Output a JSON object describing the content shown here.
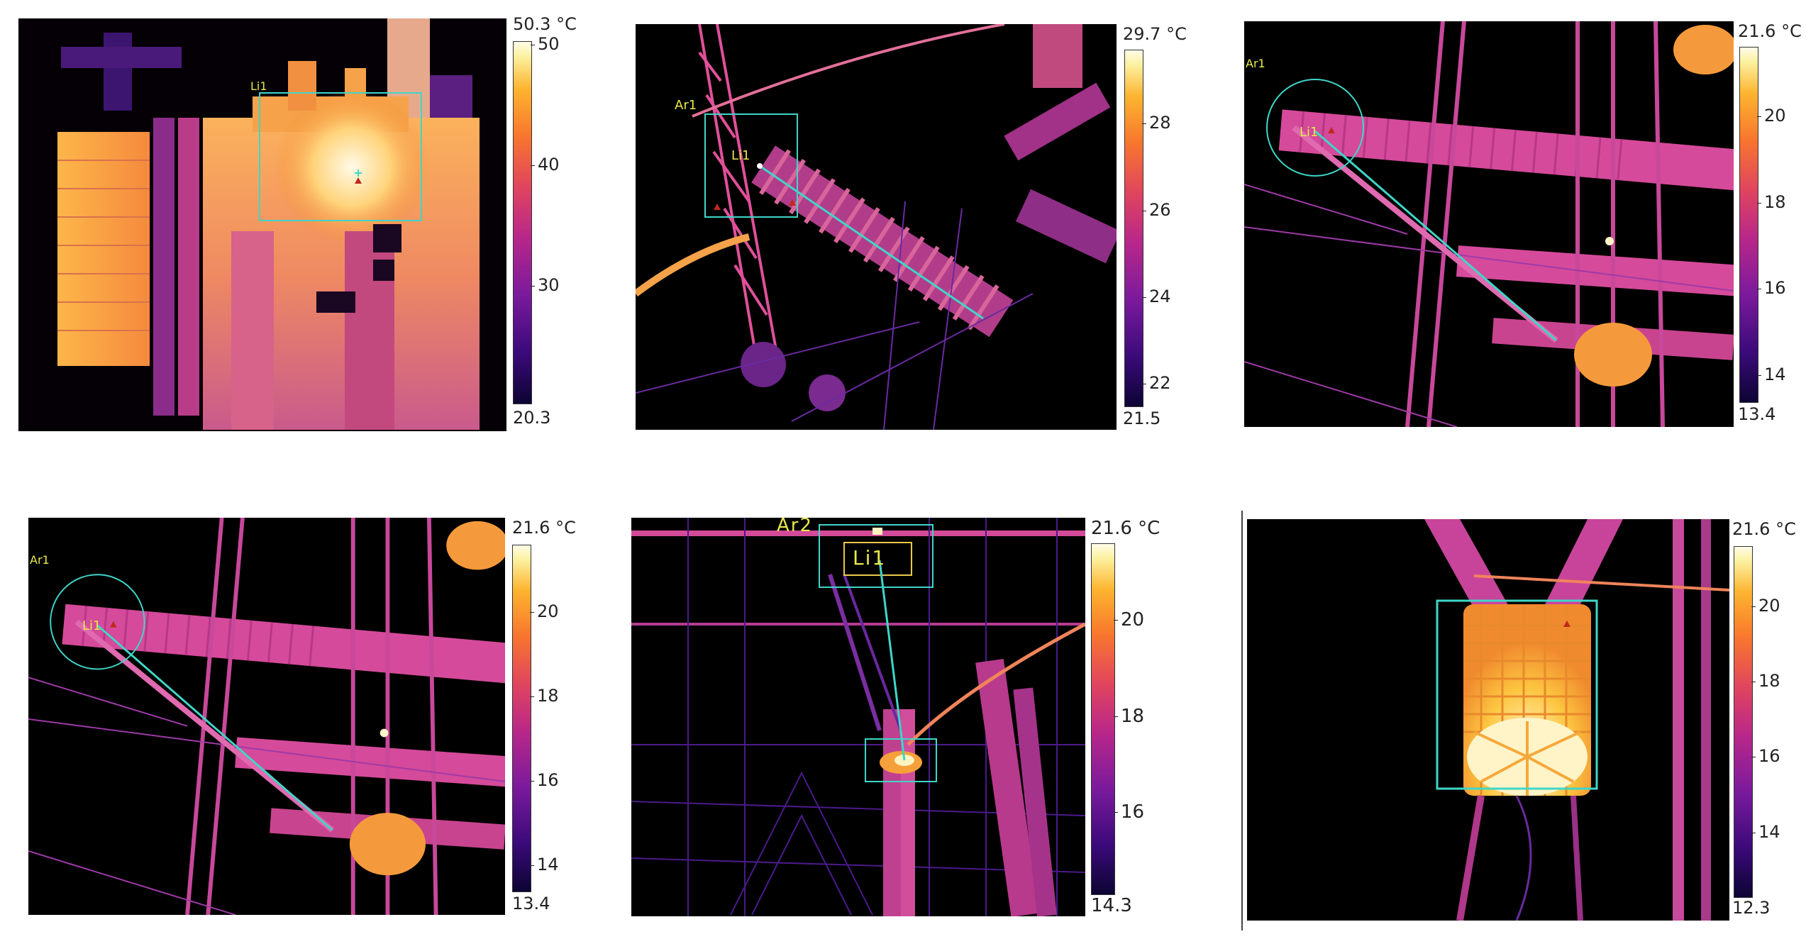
{
  "panels": [
    {
      "id": "p1",
      "max_label": "50.3 °C",
      "min_label": "20.3",
      "ticks": [
        {
          "label": "50",
          "value": 50
        },
        {
          "label": "40",
          "value": 40
        },
        {
          "label": "30",
          "value": 30
        }
      ],
      "range": [
        20.3,
        50.3
      ],
      "overlays": [
        "Li1"
      ]
    },
    {
      "id": "p2",
      "max_label": "29.7 °C",
      "min_label": "21.5",
      "ticks": [
        {
          "label": "28",
          "value": 28
        },
        {
          "label": "26",
          "value": 26
        },
        {
          "label": "24",
          "value": 24
        },
        {
          "label": "22",
          "value": 22
        }
      ],
      "range": [
        21.5,
        29.7
      ],
      "overlays": [
        "Ar1",
        "Li1"
      ]
    },
    {
      "id": "p3",
      "max_label": "21.6 °C",
      "min_label": "13.4",
      "ticks": [
        {
          "label": "20",
          "value": 20
        },
        {
          "label": "18",
          "value": 18
        },
        {
          "label": "16",
          "value": 16
        },
        {
          "label": "14",
          "value": 14
        }
      ],
      "range": [
        13.4,
        21.6
      ],
      "overlays": [
        "Ar1",
        "Li1"
      ]
    },
    {
      "id": "p4",
      "max_label": "21.6 °C",
      "min_label": "13.4",
      "ticks": [
        {
          "label": "20",
          "value": 20
        },
        {
          "label": "18",
          "value": 18
        },
        {
          "label": "16",
          "value": 16
        },
        {
          "label": "14",
          "value": 14
        }
      ],
      "range": [
        13.4,
        21.6
      ],
      "overlays": [
        "Ar1",
        "Li1"
      ]
    },
    {
      "id": "p5",
      "max_label": "21.6 °C",
      "min_label": "14.3",
      "ticks": [
        {
          "label": "20",
          "value": 20
        },
        {
          "label": "18",
          "value": 18
        },
        {
          "label": "16",
          "value": 16
        }
      ],
      "range": [
        14.3,
        21.6
      ],
      "overlays": [
        "Ar2",
        "Li1"
      ]
    },
    {
      "id": "p6",
      "max_label": "21.6 °C",
      "min_label": "12.3",
      "ticks": [
        {
          "label": "20",
          "value": 20
        },
        {
          "label": "18",
          "value": 18
        },
        {
          "label": "16",
          "value": 16
        },
        {
          "label": "14",
          "value": 14
        }
      ],
      "range": [
        12.3,
        21.6
      ],
      "overlays": []
    }
  ],
  "colors": {
    "overlay_cyan": "#3fd6c8",
    "label_yellow": "#e8e84a",
    "marker_red": "#c0281e"
  }
}
